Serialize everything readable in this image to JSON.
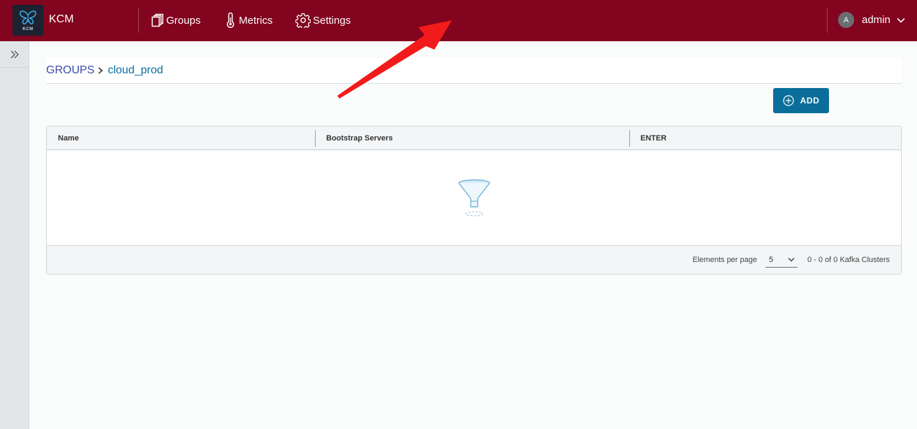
{
  "header": {
    "logo_text": "KCM",
    "app_title": "KCM",
    "nav": [
      {
        "label": "Groups",
        "icon": "groups-icon"
      },
      {
        "label": "Metrics",
        "icon": "thermometer-icon"
      },
      {
        "label": "Settings",
        "icon": "gear-icon"
      }
    ],
    "user": {
      "avatar_initial": "A",
      "name": "admin"
    }
  },
  "breadcrumb": {
    "root": "GROUPS",
    "current": "cloud_prod"
  },
  "toolbar": {
    "add_label": "ADD"
  },
  "table": {
    "columns": [
      "Name",
      "Bootstrap Servers",
      "ENTER"
    ],
    "rows": [],
    "footer": {
      "per_page_label": "Elements per page",
      "per_page_value": "5",
      "range_text": "0 - 0 of 0 Kafka Clusters"
    }
  },
  "colors": {
    "header_bg": "#82041e",
    "primary_button": "#0b6e9a",
    "annotation_arrow": "#f21b1b"
  }
}
